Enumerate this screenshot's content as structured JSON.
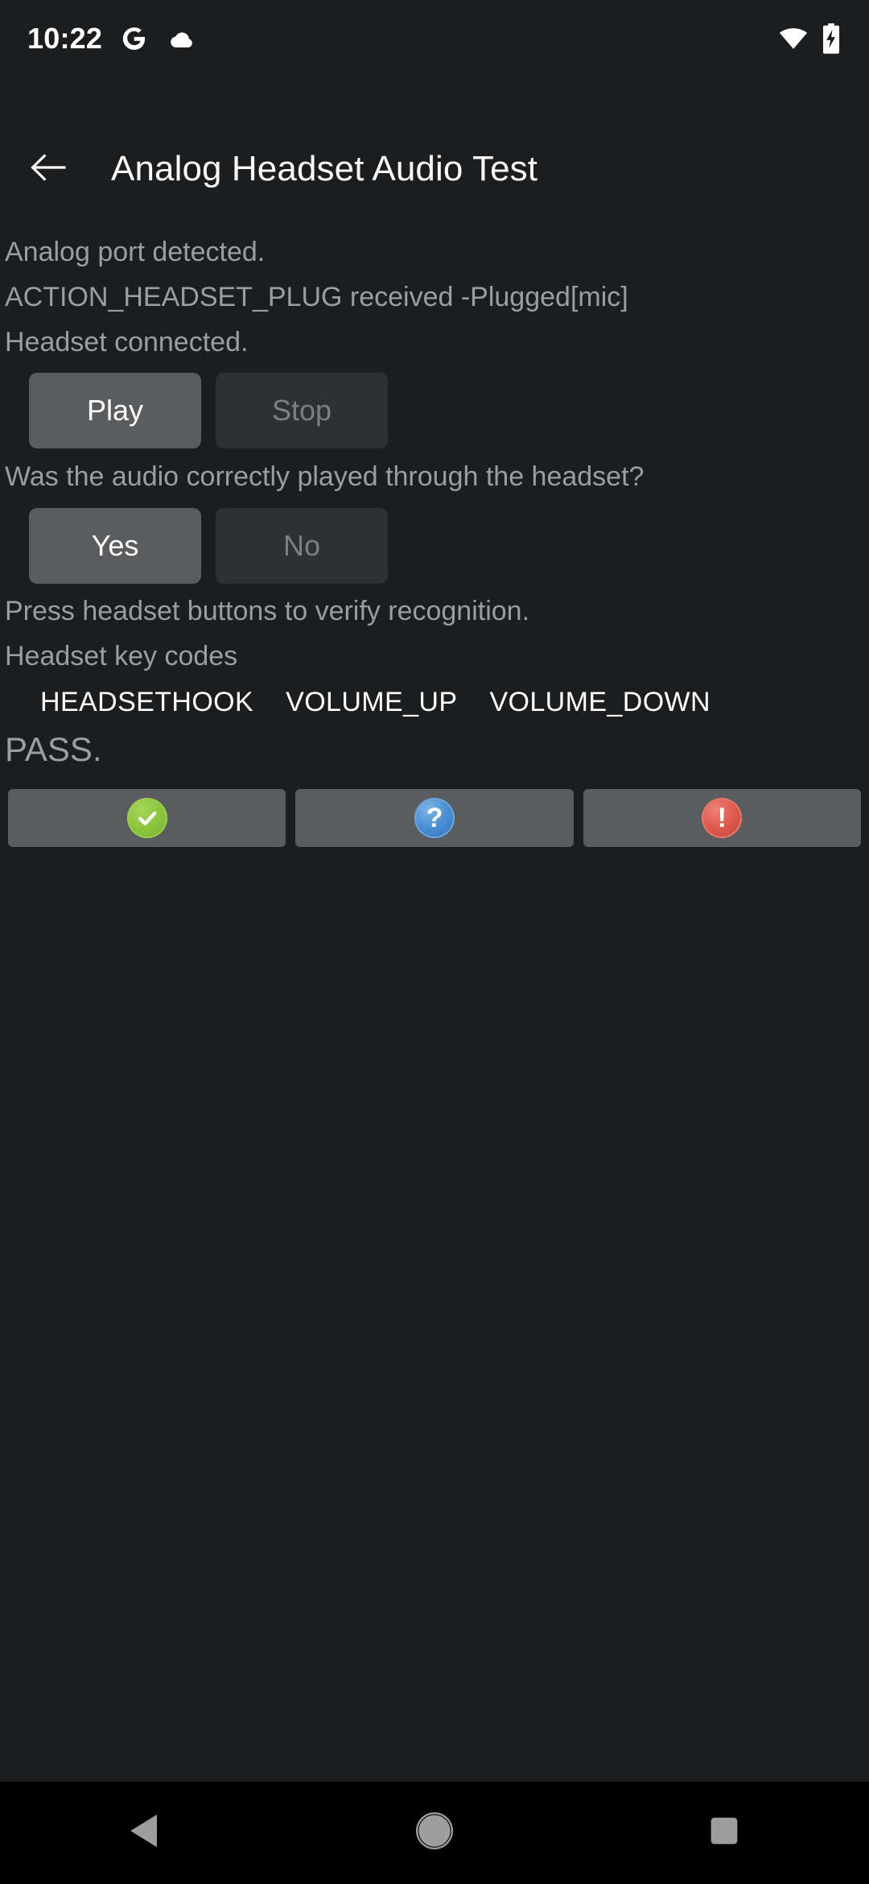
{
  "status_bar": {
    "time": "10:22",
    "icons": [
      "google-g-icon",
      "cloud-icon",
      "wifi-icon",
      "battery-charging-icon"
    ]
  },
  "app_bar": {
    "back_label": "",
    "title": "Analog Headset Audio Test"
  },
  "content": {
    "lines": [
      "Analog port detected.",
      "ACTION_HEADSET_PLUG received -Plugged[mic]",
      "Headset connected."
    ],
    "playback": {
      "play_label": "Play",
      "stop_label": "Stop"
    },
    "question": "Was the audio correctly played through the headset?",
    "answers": {
      "yes_label": "Yes",
      "no_label": "No"
    },
    "instruction": "Press headset buttons to verify recognition.",
    "keycodes_label": "Headset key codes",
    "keycodes": [
      "HEADSETHOOK",
      "VOLUME_UP",
      "VOLUME_DOWN"
    ],
    "verdict": "PASS."
  },
  "action_bar": {
    "pass_glyph": "check",
    "info_glyph": "?",
    "fail_glyph": "!"
  },
  "nav_bar": {
    "back": "back-nav-icon",
    "home": "home-nav-icon",
    "recents": "recents-nav-icon"
  },
  "colors": {
    "background": "#1c1d1f",
    "button_enabled": "#5b5c5e",
    "button_disabled": "#2e3032",
    "text_primary": "#fafafa",
    "text_secondary": "#9b9d9f",
    "pass_green": "#8cc63e",
    "info_blue": "#4a8fd4",
    "fail_red": "#dd5a4e",
    "nav_bar": "#000000"
  }
}
